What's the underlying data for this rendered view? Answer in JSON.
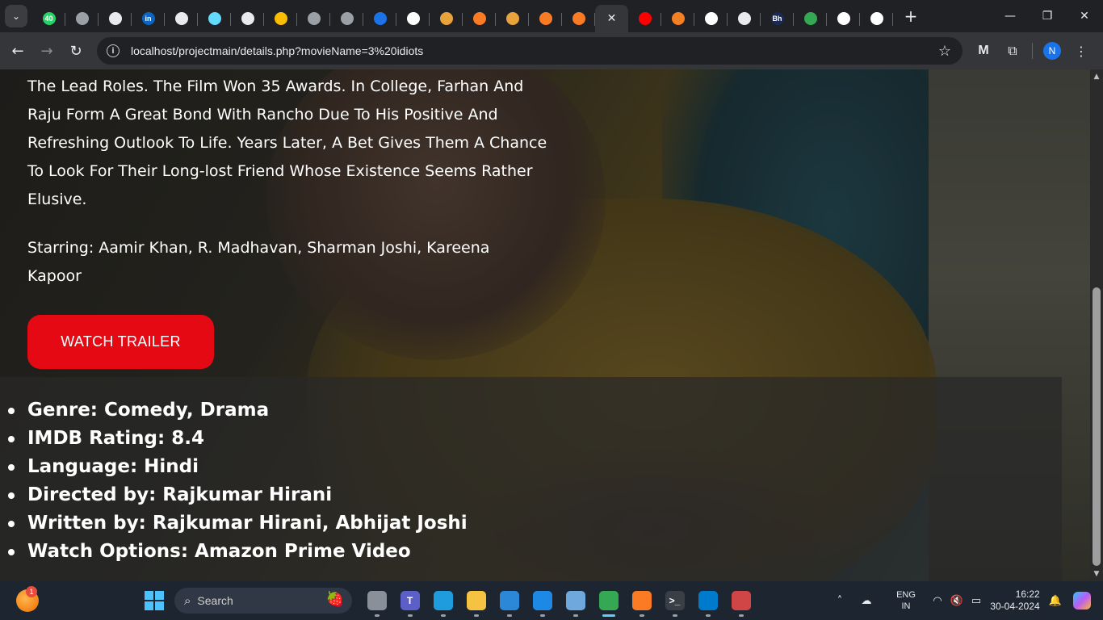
{
  "browser": {
    "tabs": [
      {
        "icon": "whatsapp-icon",
        "color": "#25d366",
        "text": "40"
      },
      {
        "icon": "globe-icon",
        "color": "#9aa0a6",
        "text": ""
      },
      {
        "icon": "github-icon",
        "color": "#e8eaed",
        "text": ""
      },
      {
        "icon": "linkedin-icon",
        "color": "#0a66c2",
        "text": "in"
      },
      {
        "icon": "github-icon",
        "color": "#e8eaed",
        "text": ""
      },
      {
        "icon": "react-icon",
        "color": "#61dafb",
        "text": ""
      },
      {
        "icon": "github-icon",
        "color": "#e8eaed",
        "text": ""
      },
      {
        "icon": "google-drive-icon",
        "color": "#fbbc04",
        "text": ""
      },
      {
        "icon": "globe-icon",
        "color": "#9aa0a6",
        "text": ""
      },
      {
        "icon": "globe-icon",
        "color": "#9aa0a6",
        "text": ""
      },
      {
        "icon": "play-icon",
        "color": "#1a73e8",
        "text": ""
      },
      {
        "icon": "google-icon",
        "color": "#ffffff",
        "text": ""
      },
      {
        "icon": "movie-icon",
        "color": "#e8a33d",
        "text": ""
      },
      {
        "icon": "xampp-icon",
        "color": "#fb7a24",
        "text": ""
      },
      {
        "icon": "movie-icon",
        "color": "#e8a33d",
        "text": ""
      },
      {
        "icon": "xampp-icon",
        "color": "#fb7a24",
        "text": ""
      },
      {
        "icon": "xampp-icon",
        "color": "#fb7a24",
        "text": ""
      },
      {
        "icon": "close-icon",
        "color": "#e8eaed",
        "text": "",
        "active": true
      },
      {
        "icon": "youtube-icon",
        "color": "#ff0000",
        "text": ""
      },
      {
        "icon": "stackoverflow-icon",
        "color": "#f48024",
        "text": ""
      },
      {
        "icon": "google-icon",
        "color": "#ffffff",
        "text": ""
      },
      {
        "icon": "github-icon",
        "color": "#e8eaed",
        "text": ""
      },
      {
        "icon": "bh-icon",
        "color": "#1b2a55",
        "text": "Bh"
      },
      {
        "icon": "leaf-icon",
        "color": "#34a853",
        "text": ""
      },
      {
        "icon": "google-icon",
        "color": "#ffffff",
        "text": ""
      },
      {
        "icon": "google-icon",
        "color": "#ffffff",
        "text": ""
      }
    ],
    "url": "localhost/projectmain/details.php?movieName=3%20idiots",
    "profile_initial": "N"
  },
  "movie": {
    "plot": "The Lead Roles. The Film Won 35 Awards. In College, Farhan And Raju Form A Great Bond With Rancho Due To His Positive And Refreshing Outlook To Life. Years Later, A Bet Gives Them A Chance To Look For Their Long-lost Friend Whose Existence Seems Rather Elusive.",
    "starring": "Starring: Aamir Khan, R. Madhavan, Sharman Joshi, Kareena Kapoor",
    "trailer_label": "WATCH TRAILER",
    "details": [
      "Genre: Comedy, Drama",
      "IMDB Rating: 8.4",
      "Language: Hindi",
      "Directed by: Rajkumar Hirani",
      "Written by: Rajkumar Hirani, Abhijat Joshi",
      "Watch Options: Amazon Prime Video"
    ],
    "accent_color": "#e50914"
  },
  "taskbar": {
    "widget_badge": "1",
    "search_placeholder": "Search",
    "apps": [
      {
        "icon": "task-view-icon",
        "color": "#8a9099",
        "text": ""
      },
      {
        "icon": "teams-icon",
        "color": "#5b5fc7",
        "text": "T"
      },
      {
        "icon": "edge-icon",
        "color": "#1f9cde",
        "text": ""
      },
      {
        "icon": "file-explorer-icon",
        "color": "#f5c242",
        "text": ""
      },
      {
        "icon": "store-icon",
        "color": "#2b88d8",
        "text": ""
      },
      {
        "icon": "app-icon",
        "color": "#1e88e5",
        "text": ""
      },
      {
        "icon": "photos-icon",
        "color": "#6fa8dc",
        "text": ""
      },
      {
        "icon": "chrome-icon",
        "color": "#34a853",
        "text": "",
        "active": true
      },
      {
        "icon": "xampp-icon",
        "color": "#fb7a24",
        "text": ""
      },
      {
        "icon": "terminal-icon",
        "color": "#3a3f47",
        "text": ">_"
      },
      {
        "icon": "vscode-icon",
        "color": "#007acc",
        "text": ""
      },
      {
        "icon": "snipping-tool-icon",
        "color": "#d04545",
        "text": ""
      }
    ],
    "lang_line1": "ENG",
    "lang_line2": "IN",
    "time": "16:22",
    "date": "30-04-2024"
  }
}
